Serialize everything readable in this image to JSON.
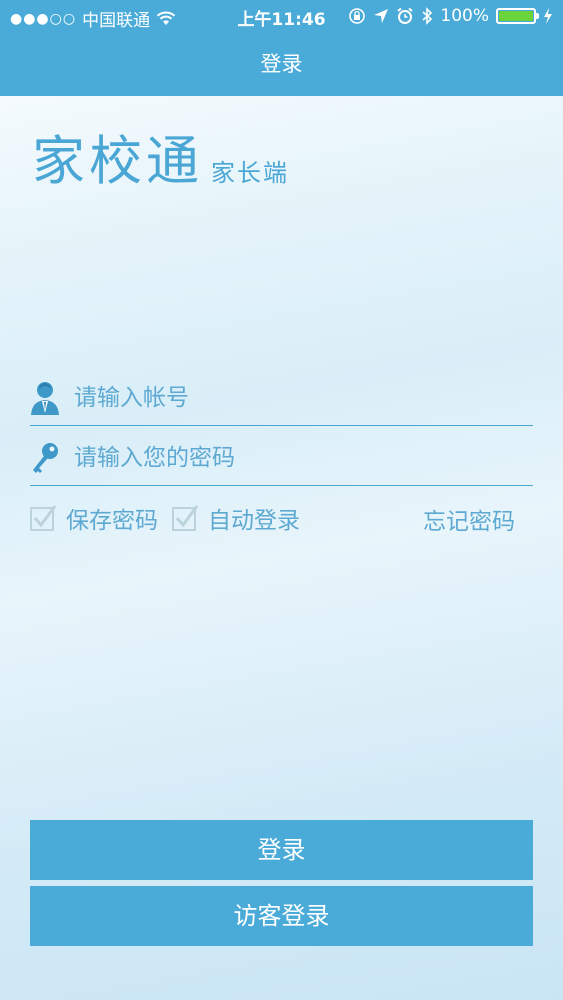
{
  "status_bar": {
    "signal_dots": "●●●○○",
    "carrier": "中国联通",
    "time": "上午11:46",
    "battery_pct": "100%",
    "battery_level": 1.0
  },
  "nav": {
    "title": "登录"
  },
  "brand": {
    "title": "家校通",
    "subtitle": "家长端"
  },
  "form": {
    "account_placeholder": "请输入帐号",
    "account_value": "",
    "password_placeholder": "请输入您的密码",
    "password_value": "",
    "save_password_label": "保存密码",
    "save_password_checked": true,
    "auto_login_label": "自动登录",
    "auto_login_checked": true,
    "forgot_label": "忘记密码"
  },
  "buttons": {
    "login": "登录",
    "guest_login": "访客登录"
  },
  "colors": {
    "accent": "#4aabd8",
    "text_accent": "#5ea9d2",
    "battery": "#6bd33c"
  },
  "icons": [
    "wifi-icon",
    "lock-rotation-icon",
    "location-icon",
    "alarm-icon",
    "bluetooth-icon",
    "battery-icon",
    "charging-icon",
    "user-icon",
    "key-icon",
    "checkbox-icon"
  ]
}
